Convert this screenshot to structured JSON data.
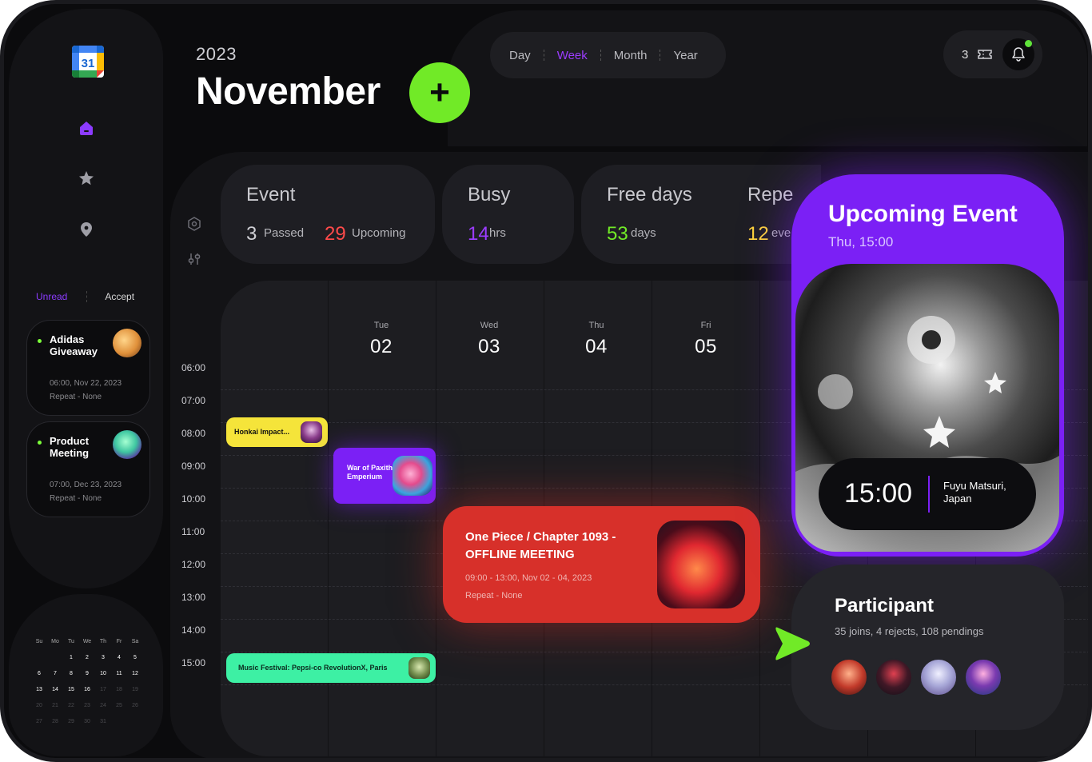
{
  "header": {
    "year": "2023",
    "month": "November",
    "add_label": "+"
  },
  "view_tabs": [
    "Day",
    "Week",
    "Month",
    "Year"
  ],
  "active_view": "Week",
  "notifications": {
    "count": "3"
  },
  "sidebar": {
    "calendar_logo_day": "31",
    "filter_tabs": {
      "unread": "Unread",
      "accept": "Accept"
    },
    "invites": [
      {
        "title": "Adidas Giveaway",
        "time": "06:00, Nov 22, 2023",
        "repeat": "Repeat - None"
      },
      {
        "title": "Product Meeting",
        "time": "07:00, Dec 23, 2023",
        "repeat": "Repeat - None"
      }
    ]
  },
  "mini_calendar": {
    "weekdays": [
      "Su",
      "Mo",
      "Tu",
      "We",
      "Th",
      "Fr",
      "Sa"
    ],
    "weeks": [
      [
        "",
        "",
        "1",
        "2",
        "3",
        "4",
        "5"
      ],
      [
        "6",
        "7",
        "8",
        "9",
        "10",
        "11",
        "12"
      ],
      [
        "13",
        "14",
        "15",
        "16",
        "17",
        "18",
        "19"
      ],
      [
        "20",
        "21",
        "22",
        "23",
        "24",
        "25",
        "26"
      ],
      [
        "27",
        "28",
        "29",
        "30",
        "31",
        "",
        ""
      ]
    ]
  },
  "stats": {
    "event": {
      "label": "Event",
      "passed_value": "3",
      "passed_label": "Passed",
      "upcoming_value": "29",
      "upcoming_label": "Upcoming"
    },
    "busy": {
      "label": "Busy",
      "value": "14",
      "unit": "hrs"
    },
    "free_days": {
      "label": "Free days",
      "value": "53",
      "unit": "days"
    },
    "repeat": {
      "label": "Repe",
      "value": "12",
      "unit": "eve"
    }
  },
  "week_days": [
    {
      "name": "Tue",
      "num": "02"
    },
    {
      "name": "Wed",
      "num": "03"
    },
    {
      "name": "Thu",
      "num": "04"
    },
    {
      "name": "Fri",
      "num": "05"
    }
  ],
  "time_labels": [
    "06:00",
    "07:00",
    "08:00",
    "09:00",
    "10:00",
    "11:00",
    "12:00",
    "13:00",
    "14:00",
    "15:00"
  ],
  "events": {
    "honkai": {
      "title": "Honkai Impact..."
    },
    "war": {
      "title": "War of Paxithl Emperium"
    },
    "one_piece": {
      "title": "One Piece / Chapter 1093 - OFFLINE MEETING",
      "time": "09:00 - 13:00, Nov 02 - 04, 2023",
      "repeat": "Repeat - None"
    },
    "music": {
      "title": "Music Festival: Pepsi-co RevolutionX, Paris"
    }
  },
  "upcoming": {
    "title": "Upcoming Event",
    "subtitle": "Thu, 15:00",
    "time": "15:00",
    "location": "Fuyu Matsuri, Japan"
  },
  "participant": {
    "title": "Participant",
    "summary": "35 joins, 4 rejects, 108 pendings"
  },
  "colors": {
    "accent_purple": "#7b20f5",
    "accent_green": "#71ea27",
    "event_yellow": "#f5e43a",
    "event_red": "#d7302a",
    "event_mint": "#3df0a4",
    "stat_red": "#ff4a4a",
    "stat_purple": "#9b3cff",
    "stat_green": "#71ea27",
    "stat_yellow": "#ffd43a"
  }
}
